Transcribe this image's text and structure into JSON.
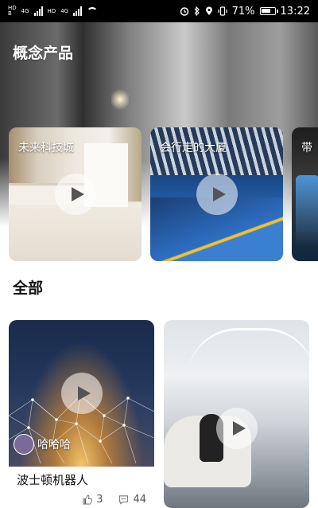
{
  "status_bar": {
    "sim1_tag_top": "HD",
    "sim1_tag_bottom": "B",
    "sim1_network": "4G",
    "sim2_tag_top": "HD",
    "sim2_network": "4G",
    "battery_percent": "71%",
    "time": "13:22",
    "icons": [
      "alarm-icon",
      "bluetooth-icon",
      "location-icon",
      "vibrate-icon",
      "battery-icon",
      "wifi-icon",
      "signal-icon"
    ]
  },
  "concept": {
    "title": "概念产品",
    "cards": [
      {
        "label": "未来科技城"
      },
      {
        "label": "会行走的大厦"
      },
      {
        "label": "带"
      }
    ]
  },
  "all": {
    "title": "全部",
    "cards": [
      {
        "title": "波士顿机器人",
        "author": "哈哈哈",
        "likes": "3",
        "comments": "44"
      },
      {
        "title": "",
        "author": "",
        "likes": "",
        "comments": ""
      }
    ]
  },
  "colors": {
    "accent_play": "#555555",
    "text_dark": "#111111"
  }
}
